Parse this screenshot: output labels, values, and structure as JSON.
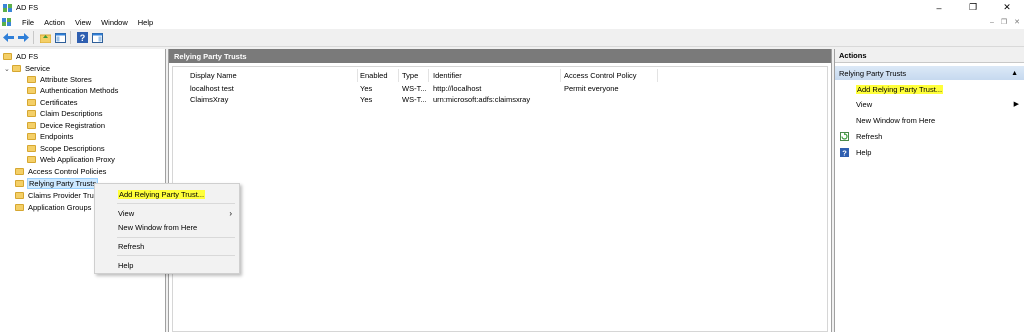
{
  "window": {
    "title": "AD FS"
  },
  "menu": [
    "File",
    "Action",
    "View",
    "Window",
    "Help"
  ],
  "tree": {
    "root": "AD FS",
    "service": "Service",
    "service_children": [
      "Attribute Stores",
      "Authentication Methods",
      "Certificates",
      "Claim Descriptions",
      "Device Registration",
      "Endpoints",
      "Scope Descriptions",
      "Web Application Proxy"
    ],
    "others": [
      "Access Control Policies",
      "Relying Party Trusts",
      "Claims Provider Tru",
      "Application Groups"
    ]
  },
  "center": {
    "title": "Relying Party Trusts",
    "columns": [
      "Display Name",
      "Enabled",
      "Type",
      "Identifier",
      "Access Control Policy"
    ],
    "rows": [
      [
        "localhost test",
        "Yes",
        "WS-T...",
        "http://localhost",
        "Permit everyone"
      ],
      [
        "ClaimsXray",
        "Yes",
        "WS-T...",
        "urn:microsoft:adfs:claimsxray",
        ""
      ]
    ]
  },
  "actions": {
    "header": "Actions",
    "section": "Relying Party Trusts",
    "items": [
      "Add Relying Party Trust...",
      "View",
      "New Window from Here",
      "Refresh",
      "Help"
    ]
  },
  "context_menu": {
    "items": [
      "Add Relying Party Trust...",
      "View",
      "New Window from Here",
      "Refresh",
      "Help"
    ]
  },
  "colors": {
    "highlight": "#ffff3a",
    "header": "#7a7a7a",
    "folder": "#f4cf67"
  }
}
